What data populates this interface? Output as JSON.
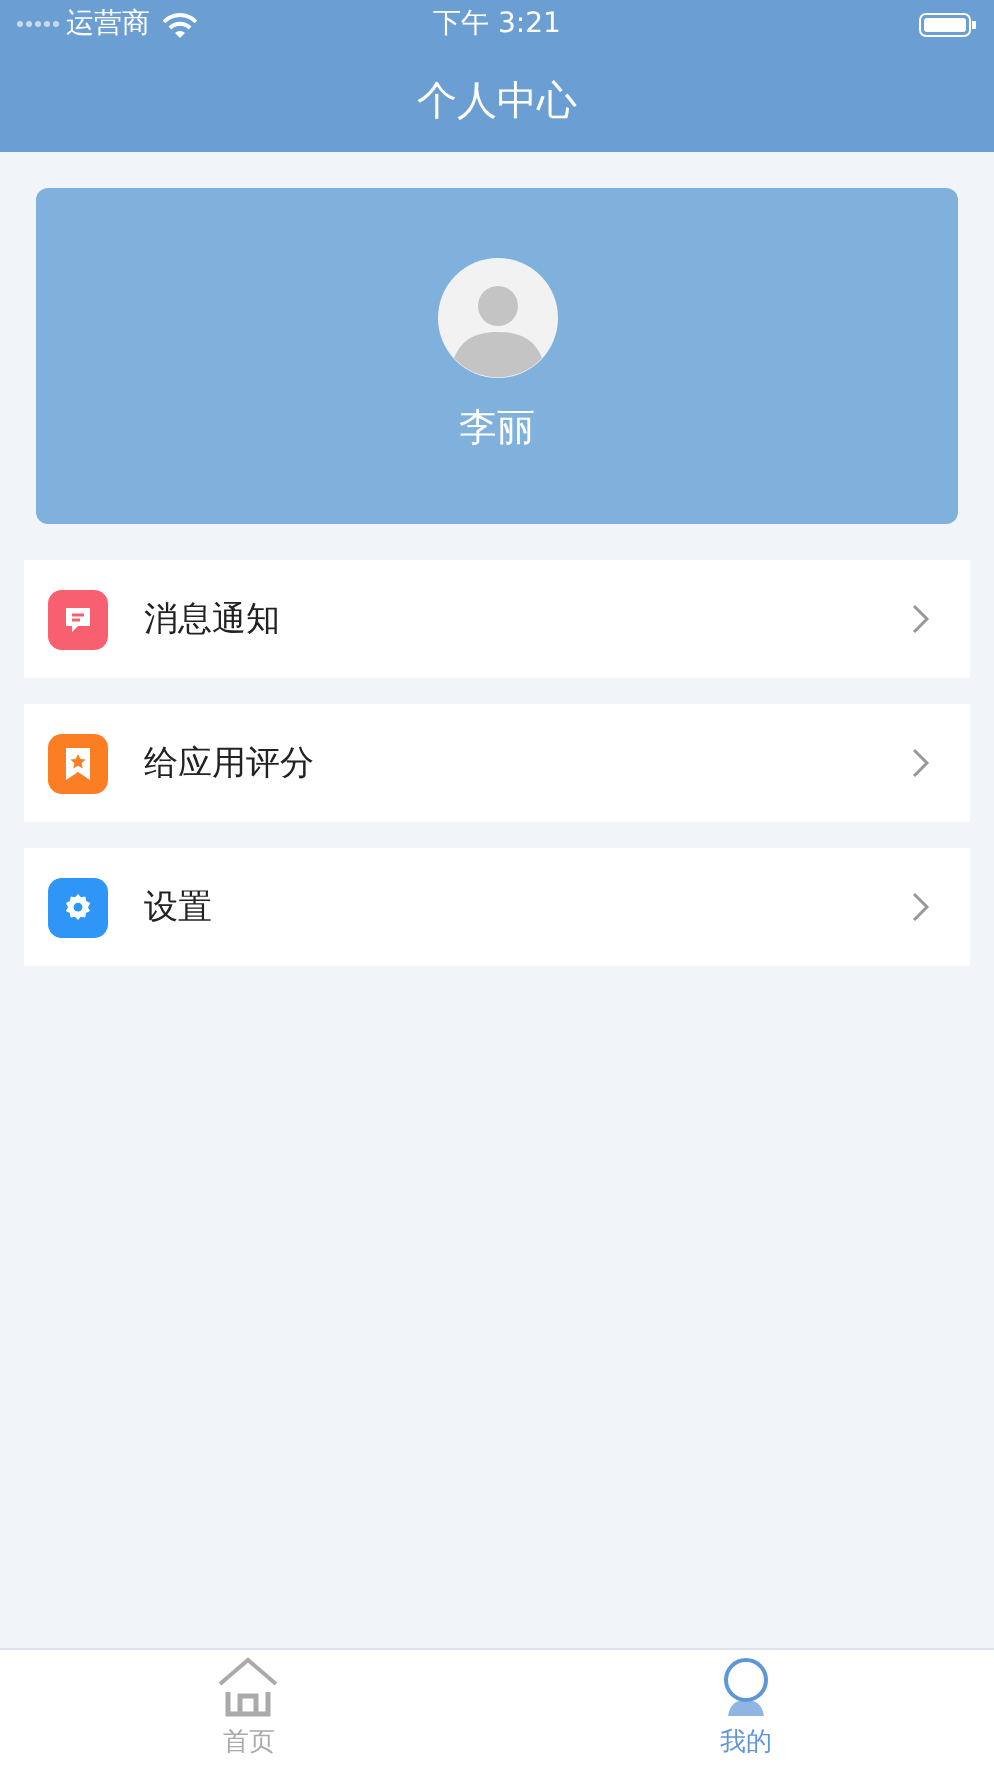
{
  "status_bar": {
    "carrier": "运营商",
    "time": "下午 3:21"
  },
  "nav": {
    "title": "个人中心"
  },
  "profile": {
    "name": "李丽"
  },
  "menu": [
    {
      "label": "消息通知",
      "kind": "message",
      "color": "#f8606f"
    },
    {
      "label": "给应用评分",
      "kind": "rate",
      "color": "#fb7d24"
    },
    {
      "label": "设置",
      "kind": "settings",
      "color": "#2f95f6"
    }
  ],
  "tabs": [
    {
      "label": "首页",
      "kind": "home",
      "selected": false
    },
    {
      "label": "我的",
      "kind": "me",
      "selected": true
    }
  ]
}
